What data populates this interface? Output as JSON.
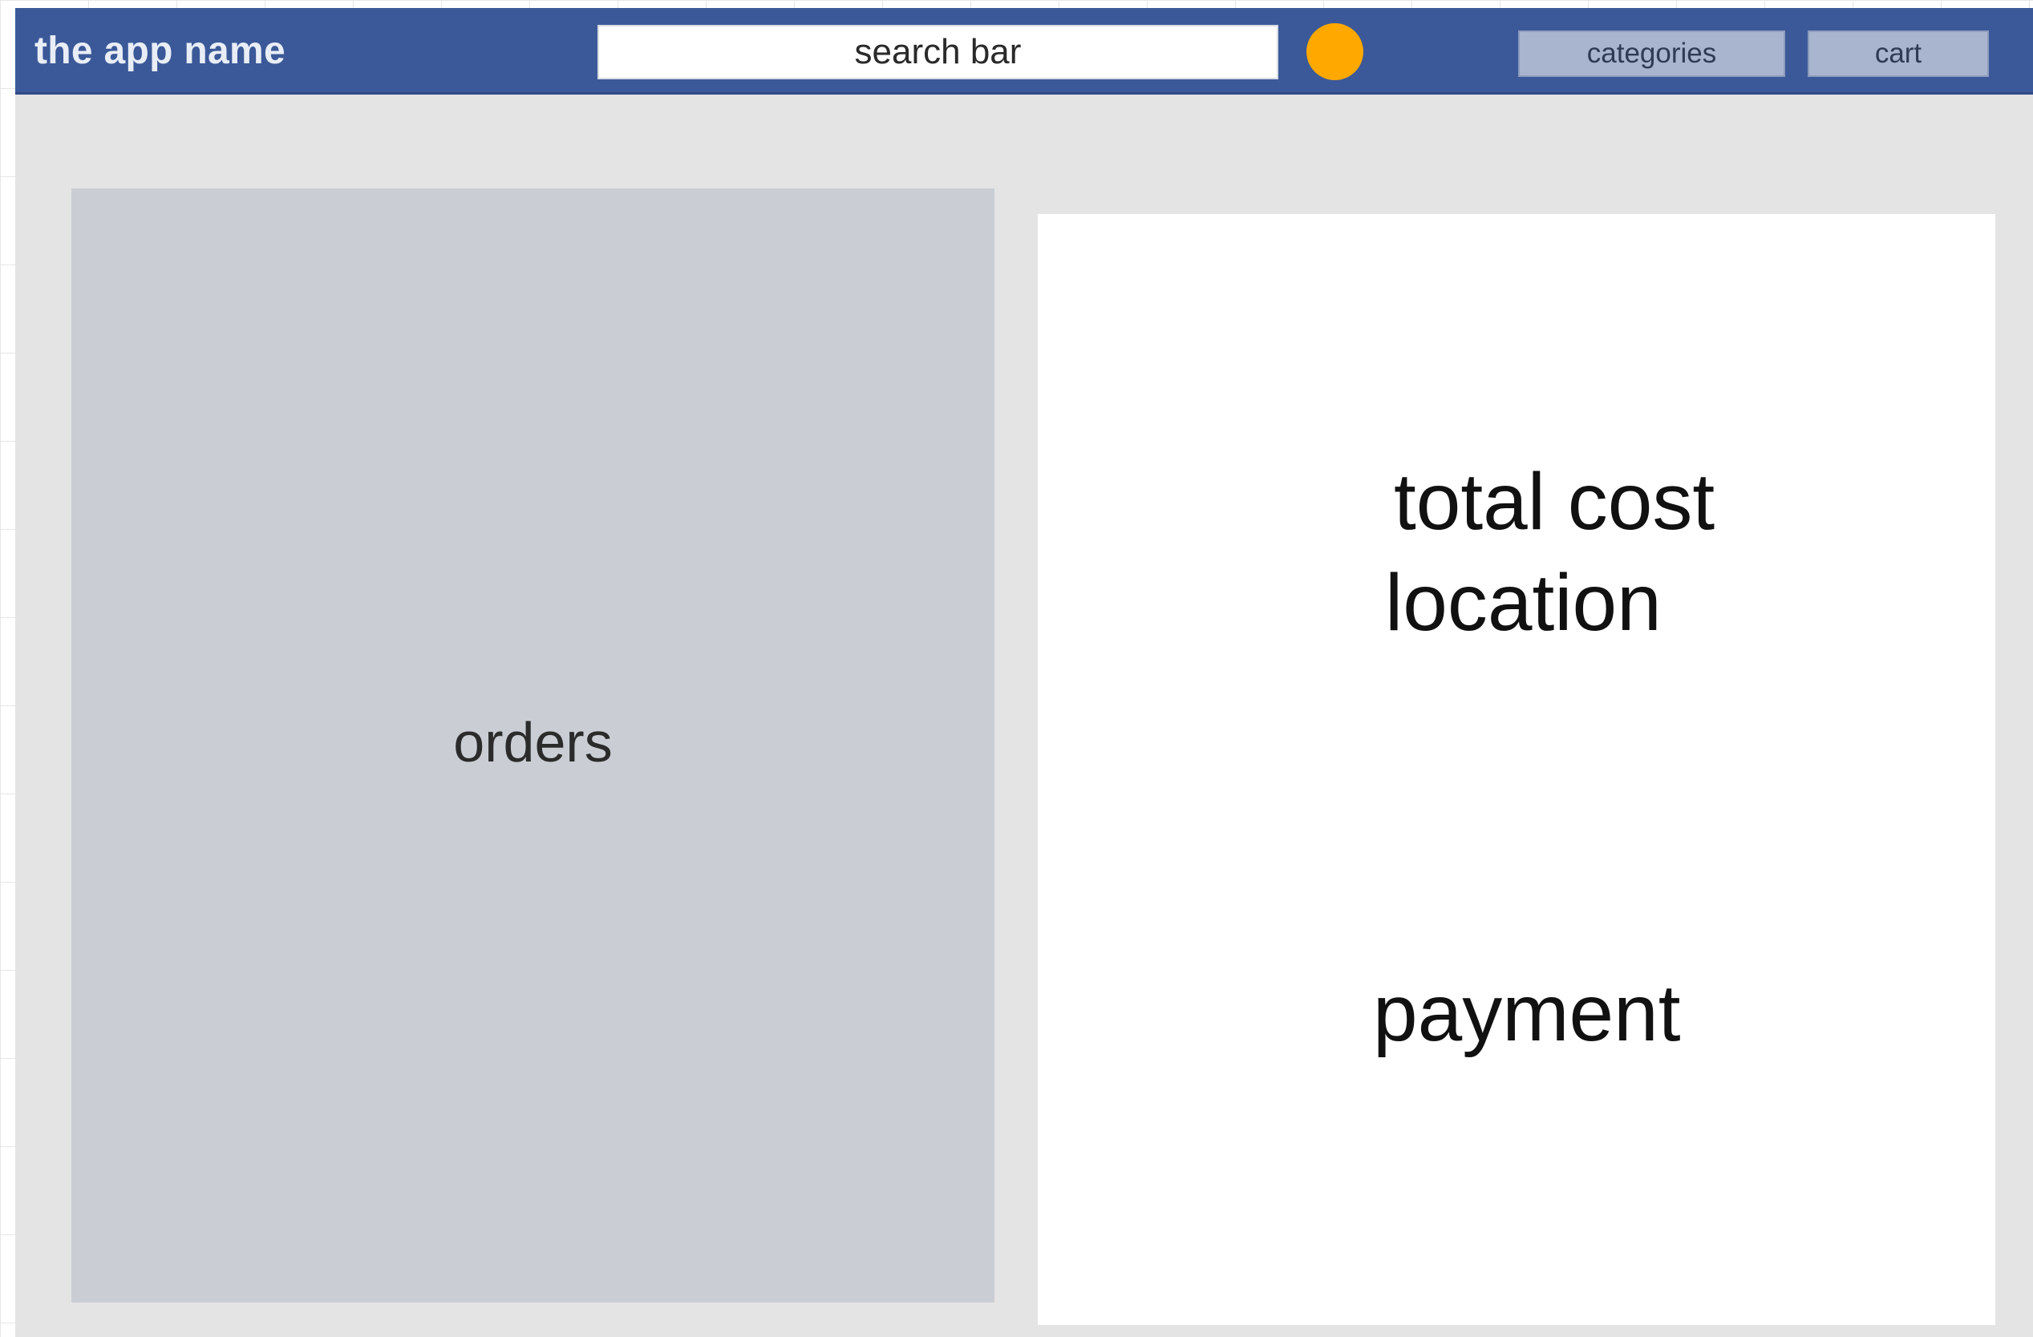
{
  "header": {
    "app_name": "the app name",
    "search_placeholder": "search bar",
    "categories_label": "categories",
    "cart_label": "cart"
  },
  "orders": {
    "label": "orders"
  },
  "summary": {
    "total_cost_label": "total cost",
    "location_label": "location",
    "payment_label": "payment"
  },
  "colors": {
    "header_bg": "#3b5998",
    "nav_button_bg": "#a9b4cf",
    "status_dot": "#ffa800",
    "orders_bg": "#caced4",
    "page_bg": "#e4e4e4"
  },
  "icons": {
    "status_dot": "orange-circle-icon"
  }
}
